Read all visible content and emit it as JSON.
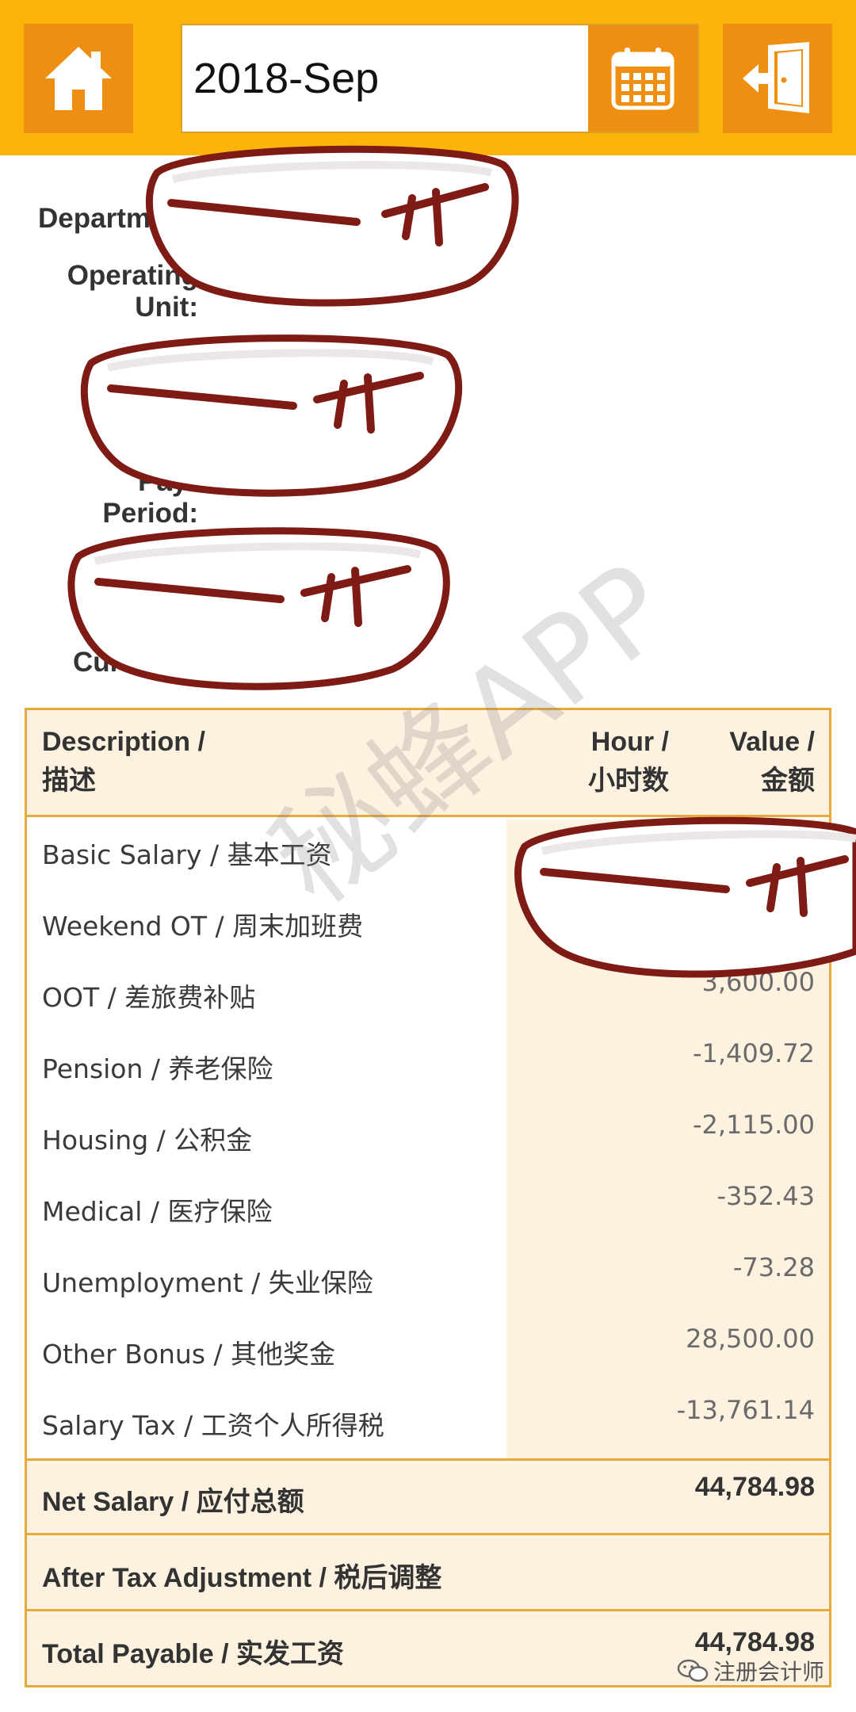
{
  "header": {
    "date_value": "2018-Sep",
    "icons": {
      "home": "home-icon",
      "calendar": "calendar-icon",
      "exit": "exit-door-icon"
    }
  },
  "info": {
    "department_label": "Departm",
    "operating_unit_label_1": "Operating",
    "operating_unit_label_2": "Unit:",
    "payroll_period_label_1": "Payr",
    "payroll_period_label_2": "Period:",
    "currency_label": "Curr"
  },
  "table": {
    "headers": {
      "description_en": "Description /",
      "description_cn": "描述",
      "hour_en": "Hour /",
      "hour_cn": "小时数",
      "value_en": "Value /",
      "value_cn": "金额"
    },
    "rows": [
      {
        "description": "Basic Salary / 基本工资",
        "value": ""
      },
      {
        "description": "Weekend OT / 周末加班费",
        "value": ""
      },
      {
        "description": "OOT / 差旅费补贴",
        "value": "3,600.00"
      },
      {
        "description": "Pension / 养老保险",
        "value": "-1,409.72"
      },
      {
        "description": "Housing / 公积金",
        "value": "-2,115.00"
      },
      {
        "description": "Medical / 医疗保险",
        "value": "-352.43"
      },
      {
        "description": "Unemployment / 失业保险",
        "value": "-73.28"
      },
      {
        "description": "Other Bonus / 其他奖金",
        "value": "28,500.00"
      },
      {
        "description": "Salary Tax / 工资个人所得税",
        "value": "-13,761.14"
      }
    ],
    "net_salary": {
      "label": "Net Salary / 应付总额",
      "value": "44,784.98"
    },
    "after_tax_adjustment": {
      "label": "After Tax Adjustment / 税后调整",
      "value": ""
    },
    "total_payable": {
      "label": "Total Payable / 实发工资",
      "value": "44,784.98"
    }
  },
  "overlay": {
    "watermark": "秘蜂APP",
    "wechat_account": "注册会计师"
  },
  "colors": {
    "topbar": "#fcb40a",
    "button": "#ef8f12",
    "table_border": "#e8a83a",
    "table_tint": "#fdf1e0",
    "redaction": "#7e1b14"
  }
}
